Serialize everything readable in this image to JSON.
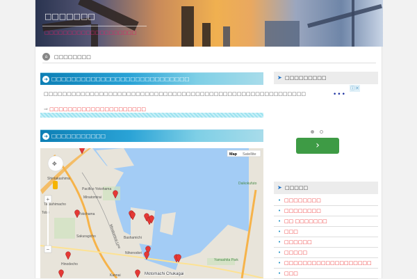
{
  "header": {
    "site_title": "□□□□□□□",
    "tagline": "□□□□□□□□□□□□□□□□□□□□"
  },
  "breadcrumb": {
    "home_icon": "home-icon",
    "current": "□□□□□□□□"
  },
  "main": {
    "section1": {
      "title": "□□□□□□□□□□□□□□□□□□□□□□□□□□□□",
      "body": "□□□□□□□□□□□□□□□□□□□□□□□□□□□□□□□□□□□□□□□□□□□□□□□□□□□□□□□□□",
      "link_arrow": "⇒",
      "link": "□□□□□□□□□□□□□□□□□□□□□"
    },
    "section2": {
      "title": "□□□□□□□□□□□"
    },
    "map": {
      "type_map": "Map",
      "type_satellite": "Satellite",
      "labels": [
        "Shintakashima",
        "Pacifico Yokohama",
        "Minatomirai",
        "Takashimacho",
        "Tobe",
        "Sakuragicho",
        "Bashamichi",
        "Nihonodori",
        "Hinodecho",
        "Kannai",
        "Motomachi Chukagai",
        "Yamashita Park",
        "Daikokufuto",
        "Minatomirai Line",
        "Yokohama"
      ]
    }
  },
  "sidebar": {
    "ad_heading": "□□□□□□□□□",
    "ad_next": "›",
    "categories_heading": "□□□□□",
    "categories": [
      "□□□□□□□□",
      "□□□□□□□□",
      "□□ □□□□□□□",
      "□□□",
      "□□□□□□",
      "□□□□□",
      "□□□□□□□□□□□□□□□□□□□",
      "□□□"
    ]
  },
  "colors": {
    "accent": "#0d7fb5",
    "link": "#e33333",
    "tagline": "#e0206a",
    "button": "#3e9b45"
  }
}
